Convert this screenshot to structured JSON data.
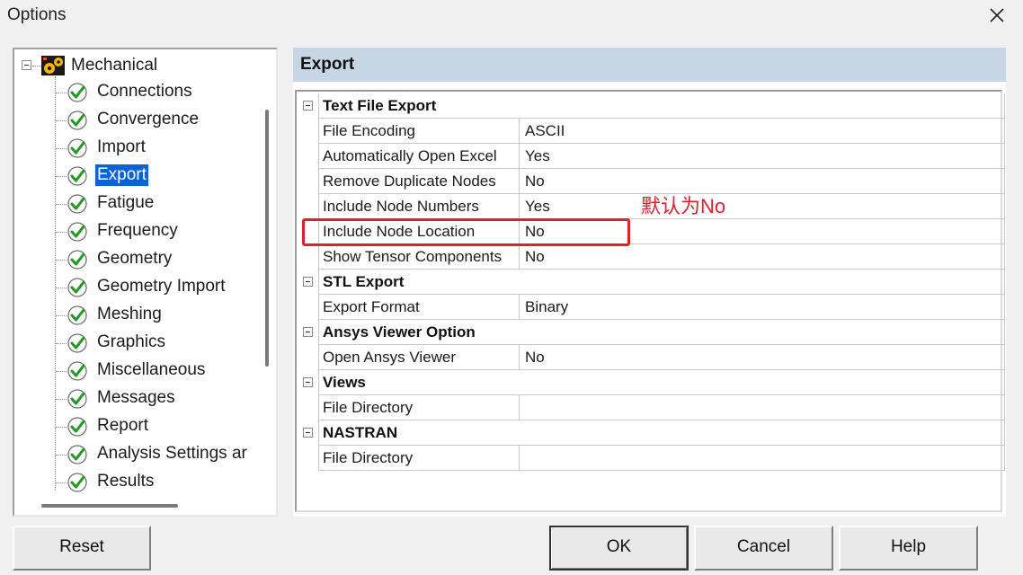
{
  "window": {
    "title": "Options"
  },
  "tree": {
    "root": "Mechanical",
    "items": [
      {
        "label": "Connections",
        "selected": false
      },
      {
        "label": "Convergence",
        "selected": false
      },
      {
        "label": "Import",
        "selected": false
      },
      {
        "label": "Export",
        "selected": true
      },
      {
        "label": "Fatigue",
        "selected": false
      },
      {
        "label": "Frequency",
        "selected": false
      },
      {
        "label": "Geometry",
        "selected": false
      },
      {
        "label": "Geometry Import",
        "selected": false
      },
      {
        "label": "Meshing",
        "selected": false
      },
      {
        "label": "Graphics",
        "selected": false
      },
      {
        "label": "Miscellaneous",
        "selected": false
      },
      {
        "label": "Messages",
        "selected": false
      },
      {
        "label": "Report",
        "selected": false
      },
      {
        "label": "Analysis Settings ar",
        "selected": false
      },
      {
        "label": "Results",
        "selected": false
      }
    ]
  },
  "panel": {
    "title": "Export",
    "rows": [
      {
        "kind": "category",
        "label": "Text File Export"
      },
      {
        "kind": "prop",
        "name": "File Encoding",
        "value": "ASCII"
      },
      {
        "kind": "prop",
        "name": "Automatically Open Excel",
        "value": "Yes"
      },
      {
        "kind": "prop",
        "name": "Remove Duplicate Nodes",
        "value": "No"
      },
      {
        "kind": "prop",
        "name": "Include Node Numbers",
        "value": "Yes"
      },
      {
        "kind": "prop",
        "name": "Include Node Location",
        "value": "No"
      },
      {
        "kind": "prop",
        "name": "Show Tensor Components",
        "value": "No"
      },
      {
        "kind": "category",
        "label": "STL Export"
      },
      {
        "kind": "prop",
        "name": "Export Format",
        "value": "Binary"
      },
      {
        "kind": "category",
        "label": "Ansys Viewer Option"
      },
      {
        "kind": "prop",
        "name": "Open Ansys Viewer",
        "value": "No"
      },
      {
        "kind": "category",
        "label": "Views"
      },
      {
        "kind": "prop",
        "name": "File Directory",
        "value": ""
      },
      {
        "kind": "category",
        "label": "NASTRAN"
      },
      {
        "kind": "prop",
        "name": "File Directory",
        "value": ""
      }
    ]
  },
  "annotation": {
    "text": "默认为No",
    "color": "#e0202c"
  },
  "buttons": {
    "reset": "Reset",
    "ok": "OK",
    "cancel": "Cancel",
    "help": "Help"
  },
  "colors": {
    "selection": "#0a64d6",
    "header_bg": "#c6d6e4"
  }
}
